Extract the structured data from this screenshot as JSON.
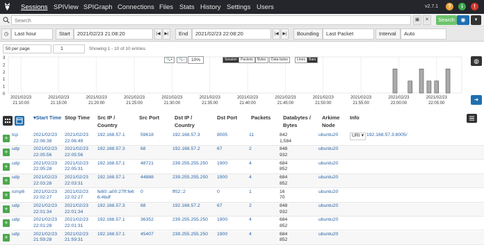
{
  "nav": {
    "items": [
      "Sessions",
      "SPIView",
      "SPIGraph",
      "Connections",
      "Files",
      "Stats",
      "History",
      "Settings",
      "Users"
    ],
    "version": "v2.7.1",
    "help": "?",
    "info": "i",
    "alert": "!"
  },
  "search": {
    "placeholder": "Search",
    "button": "Search"
  },
  "time": {
    "range": "Last hour",
    "start_label": "Start",
    "start_value": "2021/02/23 21:08:20",
    "end_label": "End",
    "end_value": "2021/02/23 22:08:20",
    "bounding_label": "Bounding",
    "bounding_value": "Last Packet",
    "interval_label": "Interval",
    "interval_value": "Auto"
  },
  "pager": {
    "per_page": "50 per page",
    "page": "1",
    "showing": "Showing 1 - 10 of 10 entries"
  },
  "graph": {
    "zoom": "10%",
    "types": [
      "Session",
      "Packets",
      "Bytes",
      "Data bytes"
    ],
    "styles": [
      "Lines",
      "Bars"
    ]
  },
  "chart_data": {
    "type": "bar",
    "y_ticks": [
      3,
      2,
      2,
      1,
      1,
      0
    ],
    "ylim": [
      0,
      3
    ],
    "x_ticks": [
      [
        "2021/02/23",
        "21:10:00"
      ],
      [
        "2021/02/23",
        "21:15:00"
      ],
      [
        "2021/02/23",
        "21:20:00"
      ],
      [
        "2021/02/23",
        "21:25:00"
      ],
      [
        "2021/02/23",
        "21:30:00"
      ],
      [
        "2021/02/23",
        "21:35:00"
      ],
      [
        "2021/02/23",
        "21:40:00"
      ],
      [
        "2021/02/23",
        "21:45:00"
      ],
      [
        "2021/02/23",
        "21:50:00"
      ],
      [
        "2021/02/23",
        "21:55:00"
      ],
      [
        "2021/02/23",
        "22:00:00"
      ],
      [
        "2021/02/23",
        "22:05:00"
      ]
    ],
    "bars": [
      {
        "t": "21:59:30",
        "v": 2
      },
      {
        "t": "22:01:30",
        "v": 1
      },
      {
        "t": "22:03:00",
        "v": 2
      },
      {
        "t": "22:04:00",
        "v": 1
      },
      {
        "t": "22:05:00",
        "v": 1
      },
      {
        "t": "22:06:30",
        "v": 2
      }
    ],
    "bar_color": "#aaaaaa"
  },
  "table": {
    "headers": [
      "Start Time",
      "Stop Time",
      "Src IP / Country",
      "Src Port",
      "Dst IP / Country",
      "Dst Port",
      "Packets",
      "Databytes / Bytes",
      "Arkime Node",
      "Info"
    ],
    "rows": [
      {
        "proto": "tcp",
        "start": [
          "2021/02/23",
          "22:06:38"
        ],
        "stop": [
          "2021/02/23",
          "22:06:49"
        ],
        "src": [
          "192.168.57.1"
        ],
        "sport": "59618",
        "dst": "192.168.57.3",
        "dport": "8005",
        "pkts": "11",
        "bytes": [
          "842",
          "1,584"
        ],
        "node": "ubuntu20",
        "info_sel": "URI",
        "info": "192.168.57.3:8005/"
      },
      {
        "proto": "udp",
        "start": [
          "2021/02/23",
          "22:05:56"
        ],
        "stop": [
          "2021/02/23",
          "22:05:56"
        ],
        "src": [
          "192.168.57.3"
        ],
        "sport": "68",
        "dst": "192.168.57.2",
        "dport": "67",
        "pkts": "2",
        "bytes": [
          "848",
          "932"
        ],
        "node": "ubuntu20",
        "info_sel": "",
        "info": ""
      },
      {
        "proto": "udp",
        "start": [
          "2021/02/23",
          "22:05:28"
        ],
        "stop": [
          "2021/02/23",
          "22:05:31"
        ],
        "src": [
          "192.168.57.1"
        ],
        "sport": "48721",
        "dst": "239.255.255.250",
        "dport": "1900",
        "pkts": "4",
        "bytes": [
          "684",
          "852"
        ],
        "node": "ubuntu20",
        "info_sel": "",
        "info": ""
      },
      {
        "proto": "udp",
        "start": [
          "2021/02/23",
          "22:03:28"
        ],
        "stop": [
          "2021/02/23",
          "22:03:31"
        ],
        "src": [
          "192.168.57.1"
        ],
        "sport": "44888",
        "dst": "239.255.255.250",
        "dport": "1900",
        "pkts": "4",
        "bytes": [
          "684",
          "852"
        ],
        "node": "ubuntu20",
        "info_sel": "",
        "info": ""
      },
      {
        "proto": "icmp6",
        "start": [
          "2021/02/23",
          "22:02:27"
        ],
        "stop": [
          "2021/02/23",
          "22:02:27"
        ],
        "src": [
          "fe80::a00:27ff:fe6",
          "6:4bdf"
        ],
        "sport": "0",
        "dst": "ff02::2",
        "dport": "0",
        "pkts": "1",
        "bytes": [
          "16",
          "70"
        ],
        "node": "ubuntu20",
        "info_sel": "",
        "info": ""
      },
      {
        "proto": "udp",
        "start": [
          "2021/02/23",
          "22:01:34"
        ],
        "stop": [
          "2021/02/23",
          "22:01:34"
        ],
        "src": [
          "192.168.57.3"
        ],
        "sport": "68",
        "dst": "192.168.57.2",
        "dport": "67",
        "pkts": "2",
        "bytes": [
          "848",
          "932"
        ],
        "node": "ubuntu20",
        "info_sel": "",
        "info": ""
      },
      {
        "proto": "udp",
        "start": [
          "2021/02/23",
          "22:01:28"
        ],
        "stop": [
          "2021/02/23",
          "22:01:31"
        ],
        "src": [
          "192.168.57.1"
        ],
        "sport": "36352",
        "dst": "239.255.255.250",
        "dport": "1900",
        "pkts": "4",
        "bytes": [
          "684",
          "852"
        ],
        "node": "ubuntu20",
        "info_sel": "",
        "info": ""
      },
      {
        "proto": "udp",
        "start": [
          "2021/02/23",
          "21:59:28"
        ],
        "stop": [
          "2021/02/23",
          "21:59:31"
        ],
        "src": [
          "192.168.57.1"
        ],
        "sport": "45407",
        "dst": "239.255.255.250",
        "dport": "1900",
        "pkts": "4",
        "bytes": [
          "684",
          "852"
        ],
        "node": "ubuntu20",
        "info_sel": "",
        "info": ""
      }
    ]
  },
  "colors": {
    "nav_bg": "#24262b",
    "accent": "#1f6fb0",
    "plus": "#4ca84c",
    "link": "#2a65a8"
  },
  "icons": [
    "owl-logo-icon",
    "search-icon",
    "save-icon",
    "clear-icon",
    "eye-icon",
    "caret-down-icon",
    "clock-icon",
    "first-page-icon",
    "last-page-icon",
    "zoom-in-icon",
    "zoom-out-icon",
    "globe-icon",
    "pin-icon",
    "plus-icon",
    "columns-icon"
  ]
}
